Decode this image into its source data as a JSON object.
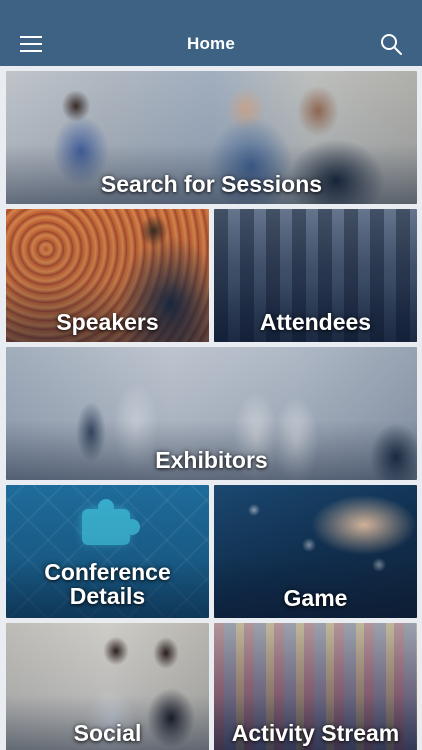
{
  "header": {
    "title": "Home",
    "menu_icon": "hamburger-menu-icon",
    "search_icon": "search-icon",
    "bar_color": "#3d6283"
  },
  "tiles": [
    {
      "label": "Search for Sessions"
    },
    {
      "label": "Speakers"
    },
    {
      "label": "Attendees"
    },
    {
      "label": "Exhibitors"
    },
    {
      "label": "Conference Details"
    },
    {
      "label": "Game"
    },
    {
      "label": "Social"
    },
    {
      "label": "Activity Stream"
    }
  ]
}
